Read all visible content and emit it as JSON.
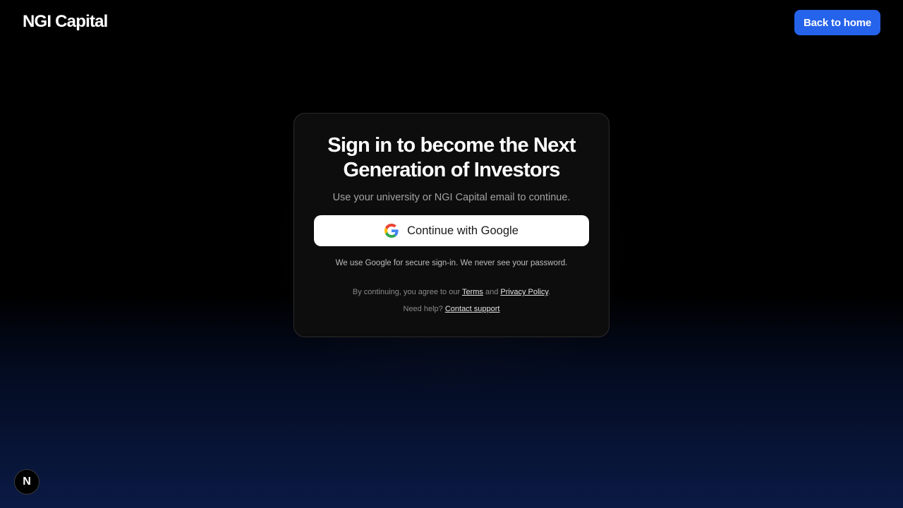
{
  "header": {
    "logo_text": "NGI Capital",
    "back_button_label": "Back to home"
  },
  "card": {
    "title": "Sign in to become the Next Generation of Investors",
    "subtitle": "Use your university or NGI Capital email to continue.",
    "google_button_label": "Continue with Google",
    "google_icon": "google-g-icon",
    "secure_note": "We use Google for secure sign-in. We never see your password.",
    "legal": {
      "prefix": "By continuing, you agree to our ",
      "terms_label": "Terms",
      "and_text": " and ",
      "privacy_label": "Privacy Policy",
      "suffix": "."
    },
    "help": {
      "prefix": "Need help? ",
      "contact_label": "Contact support"
    }
  },
  "dev_badge": {
    "letter": "N",
    "icon": "nextjs-icon"
  },
  "colors": {
    "accent": "#2563eb",
    "background_top": "#000000",
    "background_bottom": "#0a1a45",
    "card_background": "#0d0d0d"
  }
}
